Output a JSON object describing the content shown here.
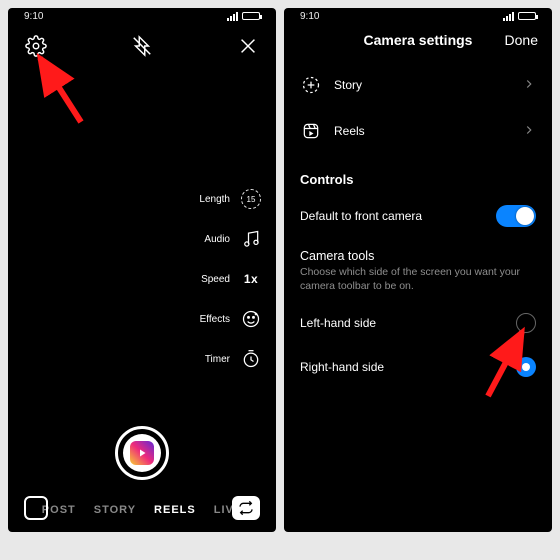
{
  "statusbar": {
    "time": "9:10"
  },
  "camera": {
    "tools": {
      "length": {
        "label": "Length",
        "value": "15"
      },
      "audio": {
        "label": "Audio"
      },
      "speed": {
        "label": "Speed",
        "value": "1x"
      },
      "effects": {
        "label": "Effects"
      },
      "timer": {
        "label": "Timer"
      }
    },
    "modes": {
      "post": "POST",
      "story": "STORY",
      "reels": "REELS",
      "live": "LIVE"
    }
  },
  "settings": {
    "title": "Camera settings",
    "done": "Done",
    "items": {
      "story": "Story",
      "reels": "Reels"
    },
    "controls_header": "Controls",
    "front_camera": "Default to front camera",
    "tools_header": "Camera tools",
    "tools_sub": "Choose which side of the screen you want your camera toolbar to be on.",
    "left_side": "Left-hand side",
    "right_side": "Right-hand side"
  }
}
